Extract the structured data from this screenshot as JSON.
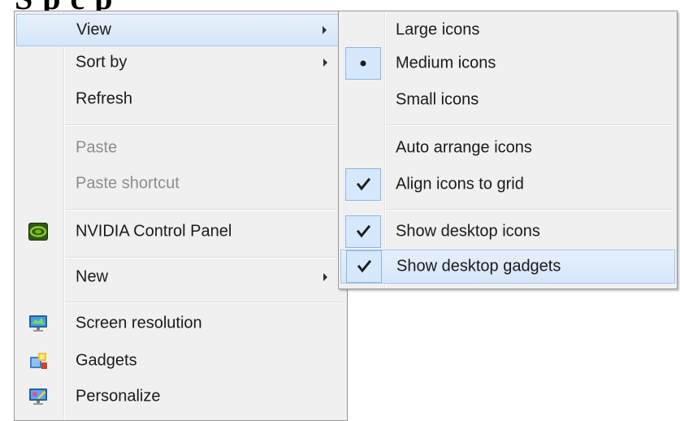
{
  "header": {
    "title_fragment": "S p c p"
  },
  "context_menu": {
    "items": [
      {
        "label": "View",
        "has_submenu": true
      },
      {
        "label": "Sort by",
        "has_submenu": true
      },
      {
        "label": "Refresh"
      },
      {
        "label": "Paste",
        "disabled": true
      },
      {
        "label": "Paste shortcut",
        "disabled": true
      },
      {
        "label": "NVIDIA Control Panel",
        "icon": "nvidia-icon"
      },
      {
        "label": "New",
        "has_submenu": true
      },
      {
        "label": "Screen resolution",
        "icon": "monitor-icon"
      },
      {
        "label": "Gadgets",
        "icon": "gadgets-icon"
      },
      {
        "label": "Personalize",
        "icon": "personalize-icon"
      }
    ]
  },
  "view_submenu": {
    "items": [
      {
        "label": "Large icons",
        "state": "none"
      },
      {
        "label": "Medium icons",
        "state": "radio-selected"
      },
      {
        "label": "Small icons",
        "state": "none"
      },
      {
        "label": "Auto arrange icons",
        "state": "unchecked"
      },
      {
        "label": "Align icons to grid",
        "state": "checked"
      },
      {
        "label": "Show desktop icons",
        "state": "checked"
      },
      {
        "label": "Show desktop gadgets",
        "state": "checked"
      }
    ]
  },
  "colors": {
    "menu_bg": "#f0f0f0",
    "hover_bg": "#d5e6f9",
    "hover_border": "#a8c8ec",
    "disabled_text": "#8d8d8d",
    "nvidia_green": "#76b900"
  }
}
